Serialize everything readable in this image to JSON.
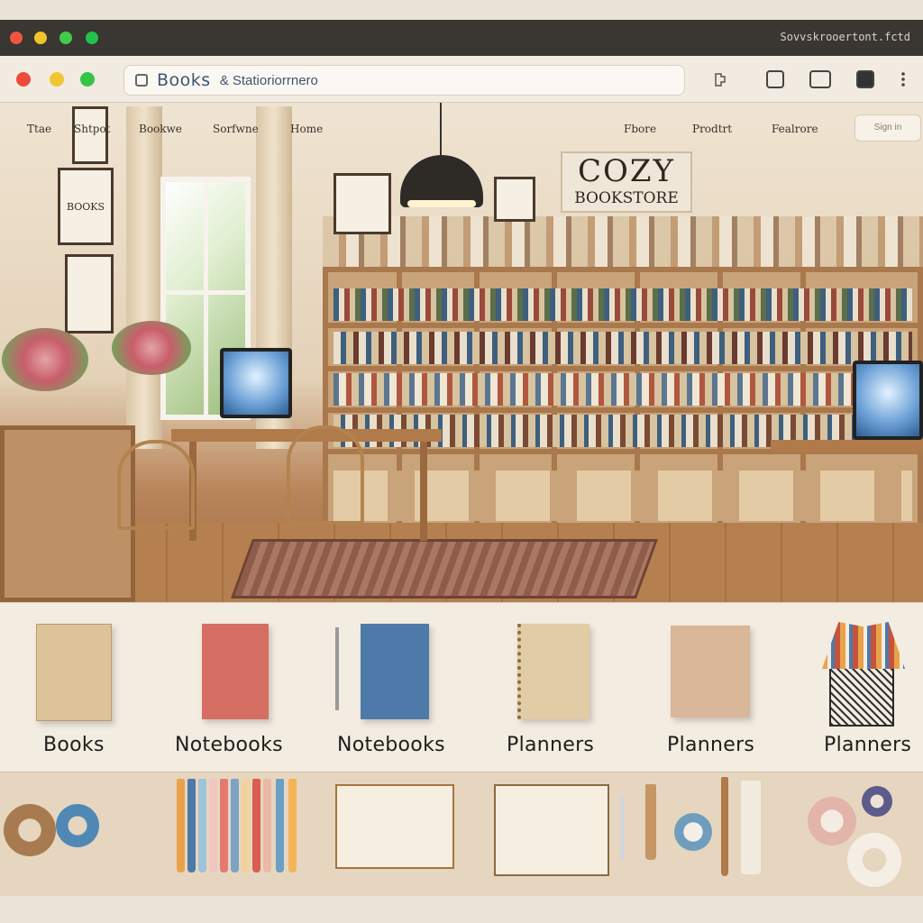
{
  "browser": {
    "outer_url": "Sovvskrooertont.fctd",
    "inner_address_site": "Books",
    "inner_address_rest": "& Statioriorrnero"
  },
  "nav": {
    "left_items": [
      "Ttae",
      "Shtpot",
      "Bookwe",
      "Sorfwne",
      "Home"
    ],
    "right_items": [
      "Fbore",
      "Prodtrt",
      "Fealrore"
    ],
    "cta_label": "Sign in"
  },
  "scene": {
    "sign_line1": "COZY",
    "sign_line2": "BOOKSTORE",
    "wall_frame_left": "BOOKS"
  },
  "categories": [
    {
      "label": "Books"
    },
    {
      "label": "Notebooks"
    },
    {
      "label": "Notebooks"
    },
    {
      "label": "Planners"
    },
    {
      "label": "Planners"
    },
    {
      "label": "Planners"
    }
  ],
  "colors": {
    "accent_text": "#3e5570",
    "wood": "#a9784c",
    "background": "#f3ece1"
  }
}
